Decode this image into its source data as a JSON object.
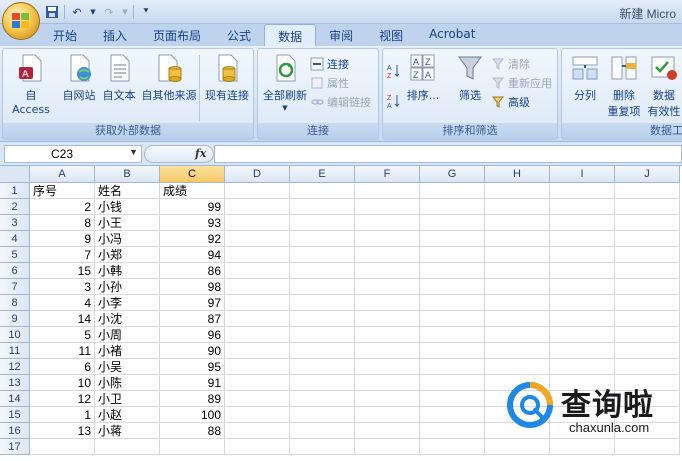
{
  "titlebar": {
    "title": "新建 Micro"
  },
  "tabs": [
    {
      "label": "开始"
    },
    {
      "label": "插入"
    },
    {
      "label": "页面布局"
    },
    {
      "label": "公式"
    },
    {
      "label": "数据",
      "active": true
    },
    {
      "label": "审阅"
    },
    {
      "label": "视图"
    },
    {
      "label": "Acrobat"
    }
  ],
  "ribbon": {
    "get_external": {
      "label": "获取外部数据",
      "buttons": [
        "自 Access",
        "自网站",
        "自文本",
        "自其他来源",
        "现有连接"
      ]
    },
    "connections": {
      "label": "连接",
      "refresh_all": "全部刷新",
      "connections": "连接",
      "properties": "属性",
      "edit_links": "编辑链接"
    },
    "sort_filter": {
      "label": "排序和筛选",
      "sort": "排序...",
      "filter": "筛选",
      "clear": "清除",
      "reapply": "重新应用",
      "advanced": "高级"
    },
    "data_tools": {
      "label": "数据工",
      "text_to_columns": "分列",
      "remove_duplicates_1": "删除",
      "remove_duplicates_2": "重复项",
      "validation_1": "数据",
      "validation_2": "有效性"
    }
  },
  "formula_bar": {
    "name_box": "C23",
    "fx": "fx",
    "formula": ""
  },
  "sheet": {
    "columns": [
      "A",
      "B",
      "C",
      "D",
      "E",
      "F",
      "G",
      "H",
      "I",
      "J"
    ],
    "selected_column": "C",
    "rows": [
      [
        "序号",
        "姓名",
        "成绩"
      ],
      [
        "2",
        "小钱",
        "99"
      ],
      [
        "8",
        "小王",
        "93"
      ],
      [
        "9",
        "小冯",
        "92"
      ],
      [
        "7",
        "小郑",
        "94"
      ],
      [
        "15",
        "小韩",
        "86"
      ],
      [
        "3",
        "小孙",
        "98"
      ],
      [
        "4",
        "小李",
        "97"
      ],
      [
        "14",
        "小沈",
        "87"
      ],
      [
        "5",
        "小周",
        "96"
      ],
      [
        "11",
        "小褚",
        "90"
      ],
      [
        "6",
        "小吴",
        "95"
      ],
      [
        "10",
        "小陈",
        "91"
      ],
      [
        "12",
        "小卫",
        "89"
      ],
      [
        "1",
        "小赵",
        "100"
      ],
      [
        "13",
        "小蒋",
        "88"
      ],
      [
        "",
        "",
        ""
      ]
    ],
    "row_numbers": [
      "1",
      "2",
      "3",
      "4",
      "5",
      "6",
      "7",
      "8",
      "9",
      "10",
      "11",
      "12",
      "13",
      "14",
      "15",
      "16",
      "17"
    ]
  },
  "watermark": {
    "cn": "查询啦",
    "en": "chaxunla.com"
  }
}
